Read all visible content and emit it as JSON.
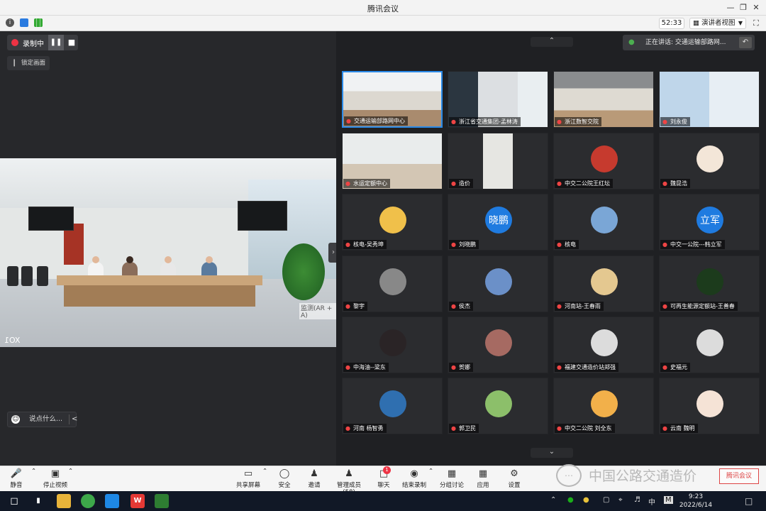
{
  "window": {
    "title": "腾讯会议",
    "minimize_icon": "minimize-icon",
    "maximize_icon": "maximize-icon",
    "close_icon": "close-icon"
  },
  "infobar": {
    "timer": "52:33",
    "view_label": "演讲者视图"
  },
  "recording": {
    "label": "录制中"
  },
  "lock_label": "锁定画面",
  "main_video": {
    "watermark": "监测(AR + A)",
    "label": "XO1"
  },
  "chat": {
    "placeholder": "说点什么..."
  },
  "speaking": {
    "text": "正在讲话: 交通运输部路网..."
  },
  "participants": [
    {
      "name": "交通运输部路网中心",
      "type": "video",
      "active": true
    },
    {
      "name": "浙江省交通集团-孟林涛",
      "type": "video"
    },
    {
      "name": "浙江数智交院",
      "type": "video"
    },
    {
      "name": "刘永俊",
      "type": "video"
    },
    {
      "name": "水运定额中心",
      "type": "video"
    },
    {
      "name": "造价",
      "type": "video"
    },
    {
      "name": "中交二公院王红坛",
      "type": "avatar",
      "color": "#c63a2e"
    },
    {
      "name": "魏昆浩",
      "type": "avatar",
      "color": "#f3e6d8"
    },
    {
      "name": "核电-吴秀坤",
      "type": "avatar",
      "color": "#f0c04a"
    },
    {
      "name": "刘晓鹏",
      "type": "text",
      "avatar_text": "晓鹏",
      "color": "#1f7be0"
    },
    {
      "name": "核电",
      "type": "avatar",
      "color": "#7aa6d6"
    },
    {
      "name": "中交一公院---韩立军",
      "type": "text",
      "avatar_text": "立军",
      "color": "#1f7be0"
    },
    {
      "name": "黎宇",
      "type": "avatar",
      "color": "#888888"
    },
    {
      "name": "侯杰",
      "type": "avatar",
      "color": "#6b90c8"
    },
    {
      "name": "河南站-王春雨",
      "type": "avatar",
      "color": "#e4c890"
    },
    {
      "name": "可再生能源定额站-王善春",
      "type": "avatar",
      "color": "#1c3b1c"
    },
    {
      "name": "中海油--梁东",
      "type": "avatar",
      "color": "#2a2426"
    },
    {
      "name": "贺娜",
      "type": "avatar",
      "color": "#a66a62"
    },
    {
      "name": "福建交通造价站郑强",
      "type": "avatar",
      "color": "#dcdcdc"
    },
    {
      "name": "史福元",
      "type": "avatar",
      "color": "#dcdcdc"
    },
    {
      "name": "河南 杨智勇",
      "type": "avatar",
      "color": "#2f6fb0"
    },
    {
      "name": "郭卫民",
      "type": "avatar",
      "color": "#8cbf6a"
    },
    {
      "name": "中交二公院 刘全东",
      "type": "avatar",
      "color": "#f2b04a"
    },
    {
      "name": "云南 魏明",
      "type": "avatar",
      "color": "#f5e3d6"
    }
  ],
  "toolbar": {
    "mute": "静音",
    "stop_video": "停止视频",
    "share": "共享屏幕",
    "security": "安全",
    "invite": "邀请",
    "members": "管理成员(58)",
    "chat": "聊天",
    "end_record": "结束录制",
    "breakout": "分组讨论",
    "apps": "应用",
    "settings": "设置",
    "chat_badge": "1"
  },
  "wechat_overlay": {
    "text": "中国公路交通造价",
    "stamp": "腾讯会议"
  },
  "taskbar": {
    "time": "9:23",
    "date": "2022/6/14",
    "ime": "中",
    "ime2": "M"
  }
}
